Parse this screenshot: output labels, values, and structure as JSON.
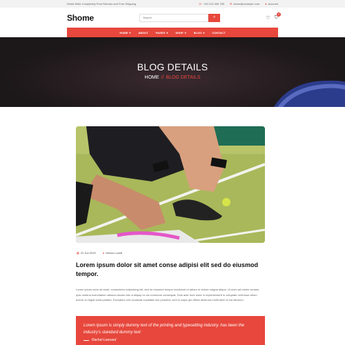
{
  "topbar": {
    "promo": "World Wide Completely Free Returns and Free Shipping",
    "phone": "+00 123 456 789",
    "email": "demo@example.com",
    "account": "Account"
  },
  "header": {
    "logo": "Shome",
    "search_placeholder": "Search",
    "cart_count": "0"
  },
  "nav": {
    "items": [
      "HOME",
      "ABOUT",
      "PAGES",
      "SHOP",
      "BLOG",
      "CONTACT"
    ]
  },
  "hero": {
    "title": "BLOG DETAILS",
    "crumb_home": "HOME",
    "crumb_sep": "//",
    "crumb_current": "BLOG DETAILS"
  },
  "post": {
    "date": "22 Jun 2022",
    "author": "Hector Lovett",
    "title": "Lorem ipsum dolor sit amet conse adipisi elit sed do eiusmod tempor.",
    "body": "Lorem ipsum dolor sit amet, consectetur adipisicing elit, sed do eiusmod tempor incididunt ut labore et dolore magna aliqua. Ut enim ad minim veniam, quis nostrud exercitation ullamco laboris nisi ut aliquip ex ea commodo consequat. Duis aute irure dolor in reprehenderit in voluptate velit esse cillum dolore eu fugiat nulla pariatur. Excepteur sint occaecat cupidatat non proident, sunt in culpa qui officia deserunt mollit anim id est laborum.",
    "quote": "Lorem Ipsum is simply dummy text of the printing and typesetting industry. has been the industry's standard dummy text",
    "quote_author": "Rachel Leonard"
  },
  "colors": {
    "accent": "#e7473c"
  }
}
